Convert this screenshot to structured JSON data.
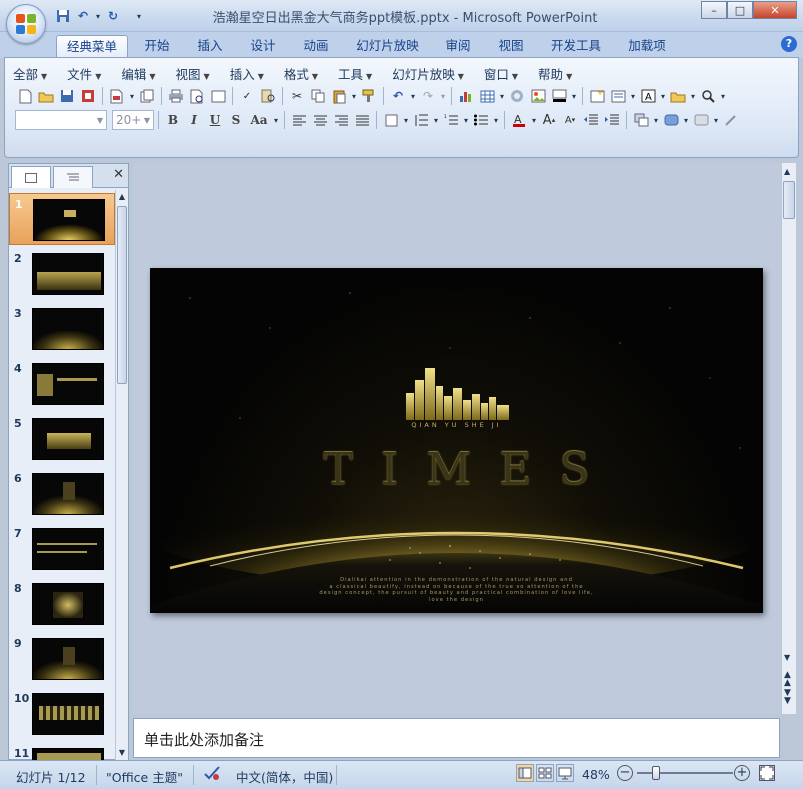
{
  "window": {
    "title": "浩瀚星空日出黑金大气商务ppt模板.pptx - Microsoft PowerPoint",
    "controls": {
      "minimize": "–",
      "maximize": "□",
      "close": "✕"
    }
  },
  "ribbon_tabs": [
    "经典菜单",
    "开始",
    "插入",
    "设计",
    "动画",
    "幻灯片放映",
    "审阅",
    "视图",
    "开发工具",
    "加载项"
  ],
  "help_label": "?",
  "classic_menu": [
    "全部",
    "文件",
    "编辑",
    "视图",
    "插入",
    "格式",
    "工具",
    "幻灯片放映",
    "窗口",
    "帮助"
  ],
  "font": {
    "name_value": "",
    "size_value": "20+"
  },
  "format_buttons": {
    "bold": "B",
    "italic": "I",
    "underline": "U",
    "shadow": "S",
    "case": "Aa"
  },
  "slide_panel": {
    "close_label": "✕",
    "slides": [
      "1",
      "2",
      "3",
      "4",
      "5",
      "6",
      "7",
      "8",
      "9",
      "10",
      "11"
    ],
    "selected_index": 0
  },
  "slide": {
    "subtitle": "QIAN YU SHE JI",
    "title": "TIMES",
    "body_lines": [
      "Dialikai attention in the demonstration of the natural design and",
      "a classical beautify, instead on because of the true so attention of the",
      "design concept, the pursuit of beauty and practical combination of love life,",
      "love the design"
    ]
  },
  "notes_placeholder": "单击此处添加备注",
  "status_bar": {
    "slide_count": "幻灯片 1/12",
    "theme": "\"Office 主题\"",
    "language": "中文(简体，中国)",
    "zoom": "48%"
  }
}
